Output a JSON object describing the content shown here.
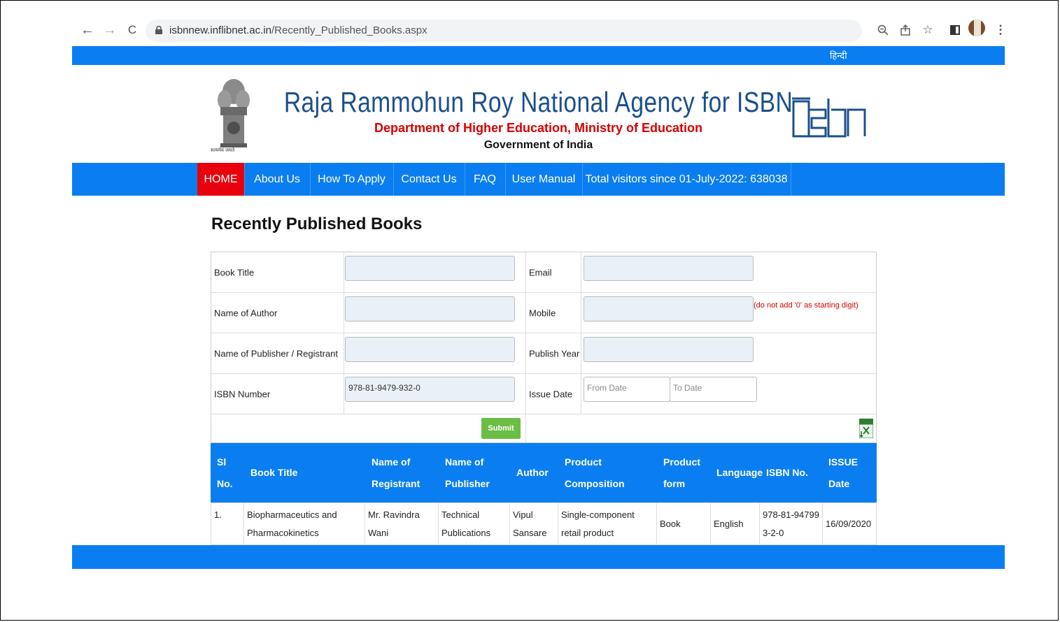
{
  "browser": {
    "url_host": "isbnnew.inflibnet.ac.in",
    "url_path": "/Recently_Published_Books.aspx",
    "back_icon": "←",
    "forward_icon": "→",
    "reload_icon": "C"
  },
  "topbar": {
    "hindi_link": "हिन्दी"
  },
  "header": {
    "title": "Raja Rammohun Roy National Agency for ISBN",
    "subtitle": "Department of Higher Education, Ministry of Education",
    "gov": "Government of India",
    "emblem_motto": "सत्यमेव जयते"
  },
  "nav": {
    "items": [
      "HOME",
      "About Us",
      "How To Apply",
      "Contact Us",
      "FAQ",
      "User Manual",
      "Total visitors since 01-July-2022: 638038"
    ]
  },
  "page": {
    "heading": "Recently Published Books"
  },
  "form": {
    "book_title_label": "Book Title",
    "author_label": "Name of Author",
    "publisher_label": "Name of Publisher / Registrant",
    "isbn_label": "ISBN Number",
    "isbn_value": "978-81-9479-932-0",
    "email_label": "Email",
    "mobile_label": "Mobile",
    "mobile_hint": "(do not add '0' as starting digit)",
    "publish_year_label": "Publish Year",
    "issue_date_label": "Issue Date",
    "from_date_placeholder": "From Date",
    "to_date_placeholder": "To Date",
    "submit_label": "Submit"
  },
  "results": {
    "headers": [
      "Sl No.",
      "Book Title",
      "Name of Registrant",
      "Name of Publisher",
      "Author",
      "Product Composition",
      "Product form",
      "Language",
      "ISBN No.",
      "ISSUE Date"
    ],
    "rows": [
      [
        "1.",
        "Biopharmaceutics and Pharmacokinetics",
        "Mr. Ravindra Wani",
        "Technical Publications",
        "Vipul Sansare",
        "Single-component retail product",
        "Book",
        "English",
        "978-81-947993-2-0",
        "16/09/2020"
      ]
    ]
  }
}
